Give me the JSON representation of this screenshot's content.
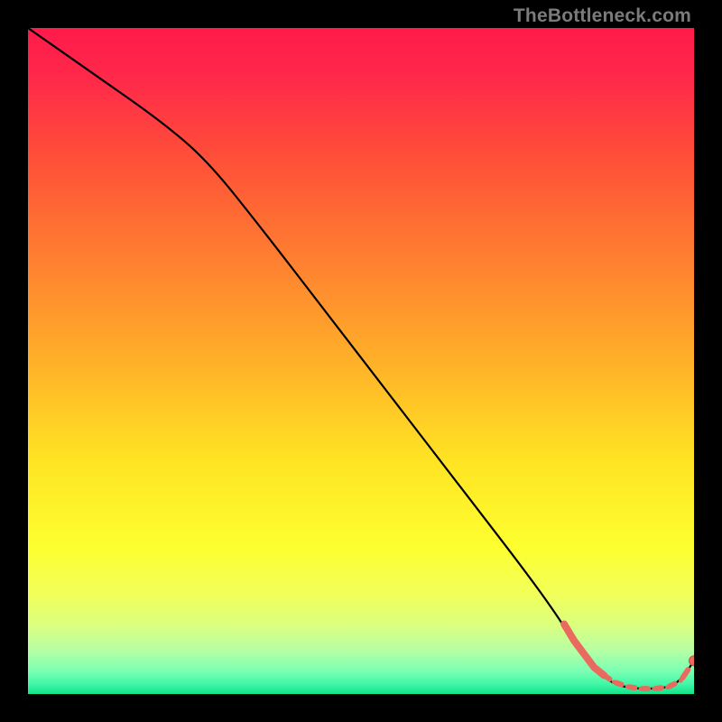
{
  "watermark": "TheBottleneck.com",
  "colors": {
    "background": "#000000",
    "curve": "#000000",
    "marker_fill": "#e96a5f",
    "marker_stroke": "#d94c45",
    "gradient_stops": [
      {
        "offset": 0.0,
        "color": "#ff1a4a"
      },
      {
        "offset": 0.08,
        "color": "#ff2a49"
      },
      {
        "offset": 0.2,
        "color": "#ff5138"
      },
      {
        "offset": 0.35,
        "color": "#ff8030"
      },
      {
        "offset": 0.5,
        "color": "#ffb029"
      },
      {
        "offset": 0.65,
        "color": "#ffe423"
      },
      {
        "offset": 0.78,
        "color": "#fdff2f"
      },
      {
        "offset": 0.85,
        "color": "#f2ff5a"
      },
      {
        "offset": 0.9,
        "color": "#d8ff82"
      },
      {
        "offset": 0.935,
        "color": "#b5ffa4"
      },
      {
        "offset": 0.965,
        "color": "#7dffb3"
      },
      {
        "offset": 0.985,
        "color": "#40f7a7"
      },
      {
        "offset": 1.0,
        "color": "#14e389"
      }
    ]
  },
  "chart_data": {
    "type": "line",
    "title": "",
    "xlabel": "",
    "ylabel": "",
    "xlim": [
      0,
      100
    ],
    "ylim": [
      0,
      100
    ],
    "series": [
      {
        "name": "curve",
        "x": [
          0,
          10,
          20,
          27,
          35,
          45,
          55,
          65,
          75,
          80,
          83,
          86,
          88,
          90,
          92,
          94,
          96,
          98,
          100
        ],
        "y": [
          100,
          93,
          86,
          80,
          70,
          57,
          44,
          31,
          18,
          11,
          6,
          3,
          1.5,
          1.0,
          0.8,
          0.8,
          1.0,
          2.0,
          5.0
        ]
      },
      {
        "name": "markers-segment",
        "x": [
          80.5,
          82,
          83.5,
          85,
          86.5,
          88,
          90,
          92,
          94,
          96,
          98,
          100
        ],
        "y": [
          10.5,
          8.0,
          6.0,
          4.0,
          2.8,
          1.8,
          1.1,
          0.8,
          0.8,
          1.0,
          2.0,
          5.0
        ]
      }
    ],
    "annotations": []
  }
}
